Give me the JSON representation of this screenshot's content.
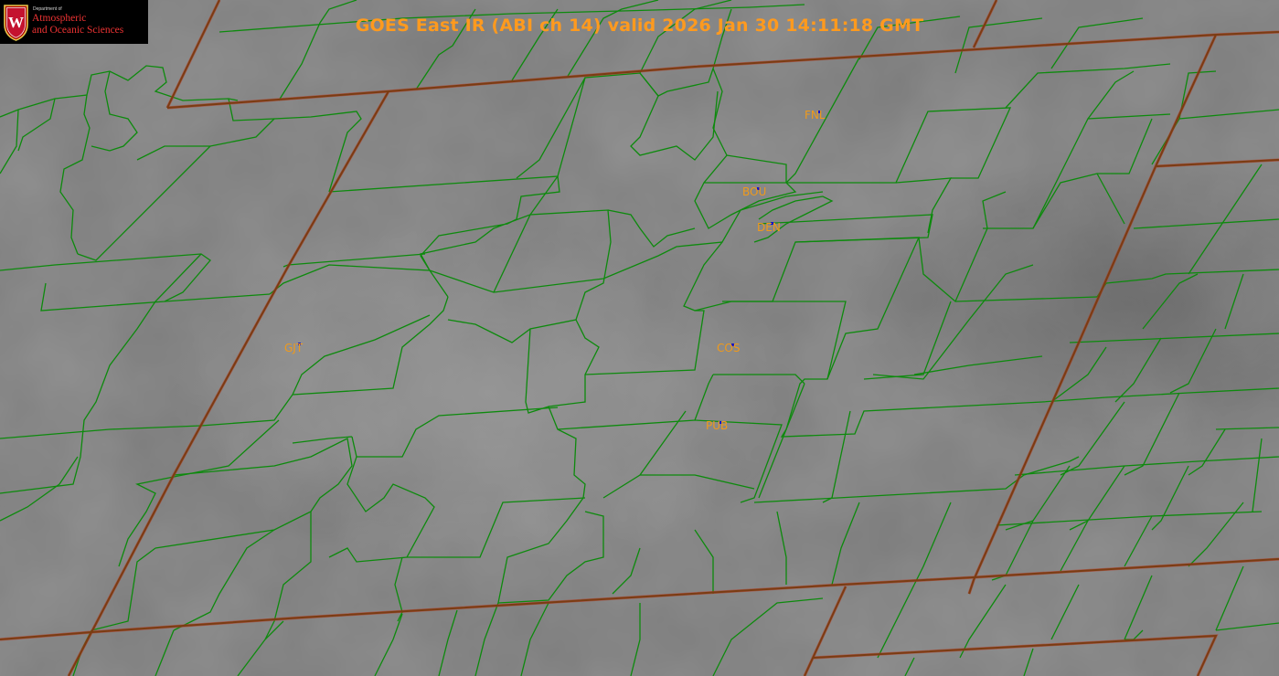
{
  "title": "GOES East IR (ABI ch 14) valid 2026 Jan 30 14:11:18 GMT",
  "logo": {
    "crest_letter": "W",
    "department": "Department of",
    "line1": "Atmospheric",
    "line2": "and Oceanic Sciences"
  },
  "stations": [
    {
      "id": "FNL"
    },
    {
      "id": "BOU"
    },
    {
      "id": "DEN"
    },
    {
      "id": "GJT"
    },
    {
      "id": "COS"
    },
    {
      "id": "PUB"
    }
  ],
  "colors": {
    "county_lines": "#0d8a0d",
    "state_lines": "#7a3c12",
    "station_labels": "#f09a1a",
    "title": "#ff9a1e",
    "station_markers": "#1111cc"
  }
}
